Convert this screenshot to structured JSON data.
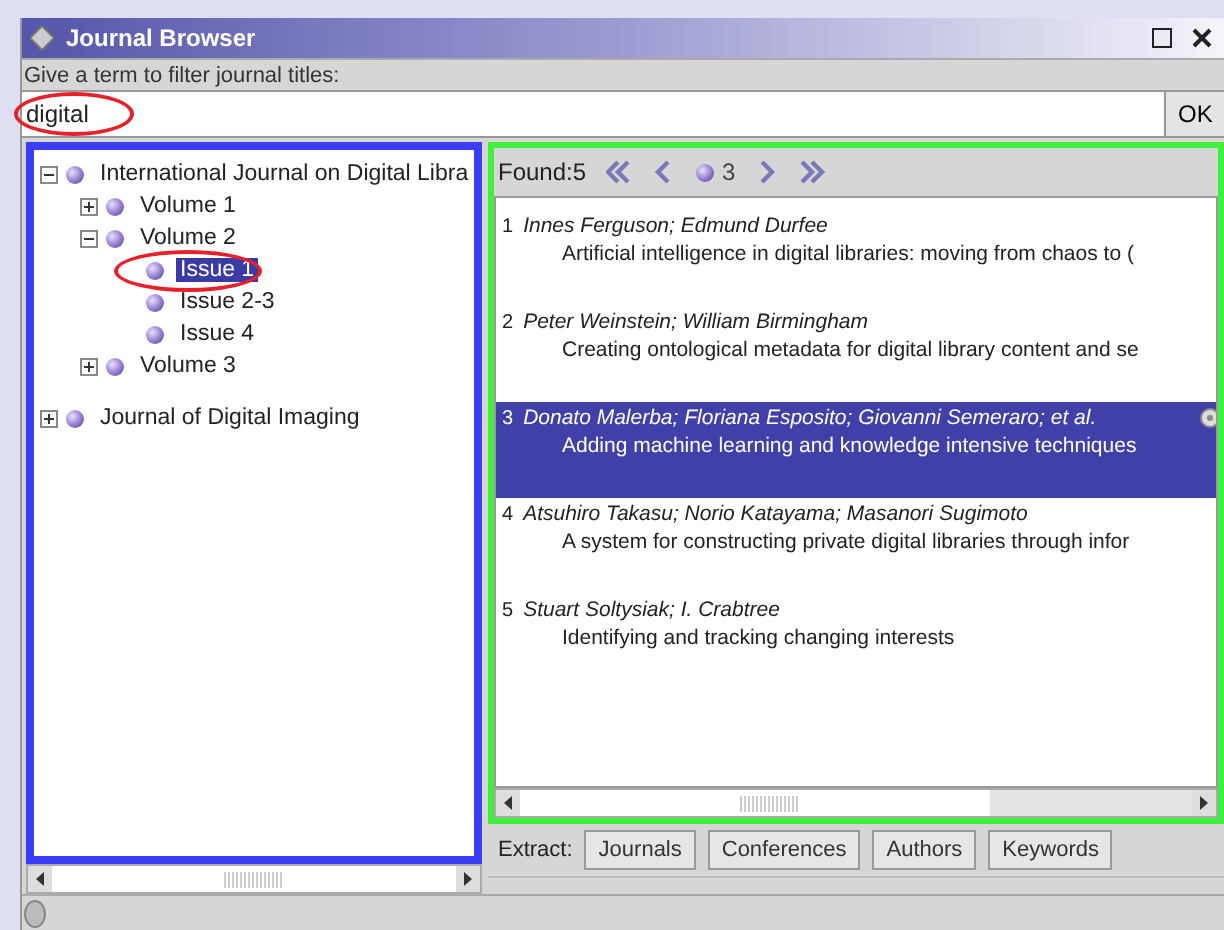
{
  "window": {
    "title": "Journal Browser"
  },
  "filter": {
    "label": "Give a term to filter journal titles:",
    "value": "digital",
    "circled": true,
    "button": "OK"
  },
  "tree": [
    {
      "label": "International Journal on Digital Libra",
      "expanded": true,
      "selected": false,
      "circled": false,
      "children": [
        {
          "label": "Volume  1",
          "expanded": false,
          "selected": false,
          "circled": false
        },
        {
          "label": "Volume  2",
          "expanded": true,
          "selected": false,
          "circled": false,
          "children": [
            {
              "label": "Issue  1",
              "selected": true,
              "circled": true
            },
            {
              "label": "Issue 2-3",
              "selected": false,
              "circled": false
            },
            {
              "label": "Issue  4",
              "selected": false,
              "circled": false
            }
          ]
        },
        {
          "label": "Volume  3",
          "expanded": false,
          "selected": false,
          "circled": false
        }
      ]
    },
    {
      "label": "Journal of Digital Imaging",
      "expanded": false,
      "selected": false,
      "circled": false
    }
  ],
  "results": {
    "found": "Found:5",
    "page": "3",
    "items": [
      {
        "number": "1",
        "authors": "Innes Ferguson; Edmund Durfee",
        "title": "Artificial intelligence in digital libraries: moving from chaos to (",
        "selected": false
      },
      {
        "number": "2",
        "authors": "Peter Weinstein; William Birmingham",
        "title": "Creating ontological metadata for digital library content and se",
        "selected": false
      },
      {
        "number": "3",
        "authors": "Donato Malerba; Floriana Esposito; Giovanni Semeraro; et al.",
        "title": "Adding machine learning and knowledge intensive techniques",
        "selected": true
      },
      {
        "number": "4",
        "authors": "Atsuhiro Takasu; Norio Katayama; Masanori Sugimoto",
        "title": "A system for constructing private digital libraries through infor",
        "selected": false
      },
      {
        "number": "5",
        "authors": "Stuart Soltysiak; I. Crabtree",
        "title": "Identifying and tracking changing interests",
        "selected": false
      }
    ]
  },
  "extract": {
    "label": "Extract:",
    "buttons": [
      "Journals",
      "Conferences",
      "Authors",
      "Keywords"
    ]
  }
}
